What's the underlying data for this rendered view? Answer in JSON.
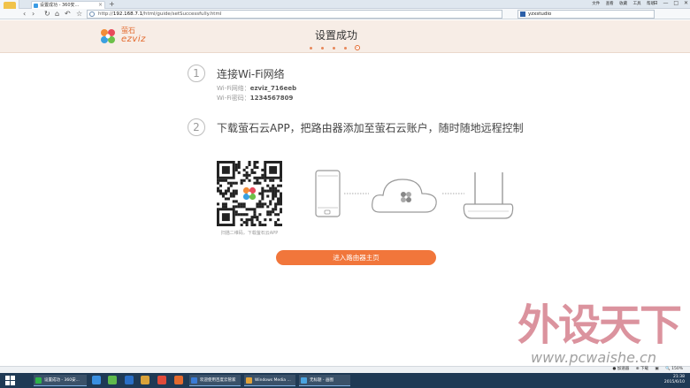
{
  "browser": {
    "tab_title": "设置成功 - 360安...",
    "new_tab_symbol": "+",
    "top_links": [
      "文件",
      "查看",
      "收藏",
      "工具",
      "帮助"
    ],
    "window_controls": [
      "⊟",
      "—",
      "□",
      "✕"
    ],
    "nav": {
      "back": "‹",
      "forward": "›",
      "refresh": "↻",
      "home": "⌂",
      "undo": "↶",
      "star": "☆"
    },
    "url_protocol": "http://",
    "url_host": "192.168.7.1",
    "url_path": "/html/guide/setSuccessfully.html",
    "search_value": "yzxstudio"
  },
  "page": {
    "logo_cn": "萤石",
    "logo_en": "ezviz",
    "title": "设置成功",
    "step_count": 5,
    "active_step": 5,
    "step1": {
      "number": "1",
      "title": "连接Wi-Fi网络",
      "network_label": "Wi-Fi网络：",
      "network_value": "ezviz_716eeb",
      "password_label": "Wi-Fi密码：",
      "password_value": "1234567809"
    },
    "step2": {
      "number": "2",
      "title": "下载萤石云APP，把路由器添加至萤石云账户，随时随地远程控制",
      "qr_caption": "扫描二维码，下载萤石云APP"
    },
    "enter_button": "进入路由器主页"
  },
  "watermark": {
    "text_cn": "外设天下",
    "url": "www.pcwaishe.cn"
  },
  "statusbar": {
    "items": [
      "● 加速器",
      "⊕ 下载",
      "▣",
      "🔍 150%"
    ]
  },
  "taskbar": {
    "items": [
      {
        "label": "设置成功 - 360安...",
        "color": "#2fb34a"
      },
      {
        "label": "欢迎使用百度云管家",
        "color": "#3a7bd5"
      },
      {
        "label": "Windows Media ...",
        "color": "#e0a23a"
      },
      {
        "label": "无标题 - 画图",
        "color": "#4aa3df"
      }
    ],
    "time": "21:38",
    "date": "2015/6/10"
  },
  "colors": {
    "accent": "#f1763b",
    "header_bg": "#f7ede6",
    "taskbar": "#1f3a55"
  }
}
